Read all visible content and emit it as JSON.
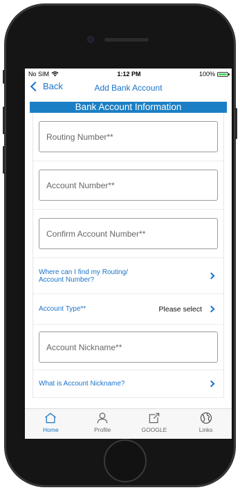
{
  "status_bar": {
    "carrier": "No SIM",
    "time": "1:12 PM",
    "battery": "100%"
  },
  "nav": {
    "back_label": "Back",
    "title": "Add Bank Account"
  },
  "section": {
    "title": "Bank Account Information"
  },
  "form": {
    "routing_placeholder": "Routing Number**",
    "account_placeholder": "Account Number**",
    "confirm_placeholder": "Confirm Account Number**",
    "find_numbers_link_line1": "Where can I find my Routing/",
    "find_numbers_link_line2": "Account Number?",
    "account_type_label": "Account Type**",
    "account_type_value": "Please select",
    "nickname_placeholder": "Account Nickname**",
    "nickname_help_link": "What is Account Nickname?"
  },
  "tabs": [
    {
      "label": "Home",
      "icon": "home-icon",
      "active": true
    },
    {
      "label": "Profile",
      "icon": "profile-icon",
      "active": false
    },
    {
      "label": "GOOGLE",
      "icon": "external-link-icon",
      "active": false
    },
    {
      "label": "Links",
      "icon": "globe-icon",
      "active": false
    }
  ],
  "colors": {
    "accent": "#1a73c9",
    "header_bg": "#1a7fc4",
    "battery": "#4cd964"
  }
}
